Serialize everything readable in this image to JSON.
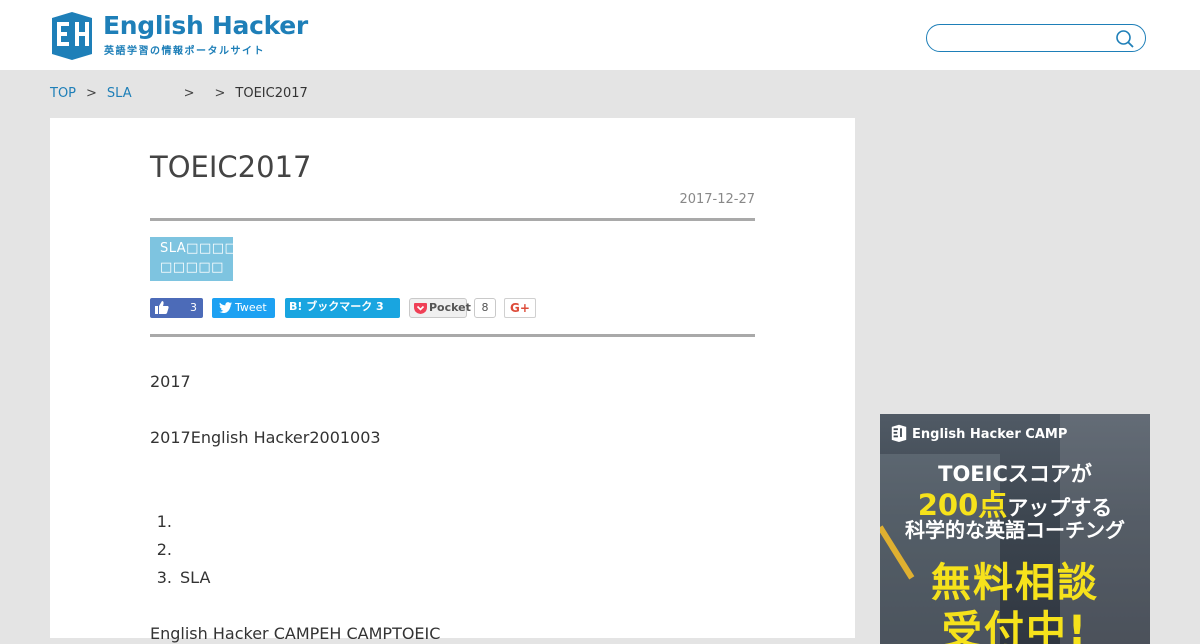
{
  "header": {
    "logo_title": "English Hacker",
    "logo_subtitle": "英語学習の情報ポータルサイト",
    "search_placeholder": "",
    "brand_color": "#1e7fb8"
  },
  "breadcrumb": {
    "items": [
      "TOP",
      "SLA",
      "TOEIC2017"
    ],
    "separator": ">"
  },
  "article": {
    "title": "TOEIC2017",
    "date": "2017-12-27",
    "tag_label": "SLA□□□□ □□□□□",
    "share": {
      "facebook_count": "3",
      "tweet_label": "Tweet",
      "hatena_label": "B! ブックマーク 3",
      "pocket_label": "Pocket",
      "pocket_count": "8",
      "gplus_label": "G+"
    },
    "paragraphs": [
      "2017",
      "2017English Hacker2001003"
    ],
    "list": [
      {
        "num": "1.",
        "text": ""
      },
      {
        "num": "2.",
        "text": ""
      },
      {
        "num": "3.",
        "text": "SLA"
      }
    ],
    "trailing_text": "English Hacker CAMPEH CAMPTOEIC"
  },
  "sidebar": {
    "banner": {
      "brand": "English Hacker CAMP",
      "line1": "TOEICスコアが",
      "line2_big": "200点",
      "line2_rest": "アップする",
      "line3": "科学的な英語コーチング",
      "line4": "無料相談",
      "line5": "受付中!",
      "accent_color": "#f6e21b"
    }
  }
}
